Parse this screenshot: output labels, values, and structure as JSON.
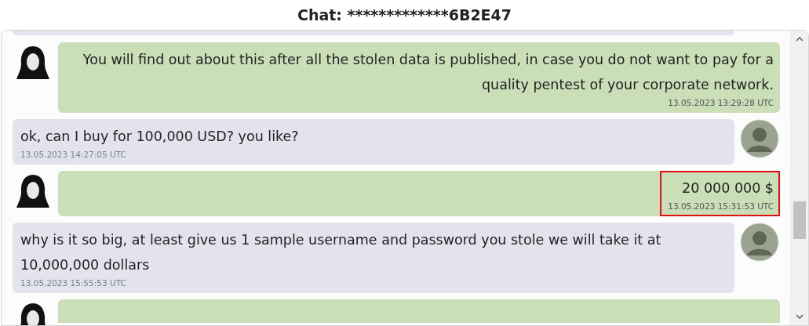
{
  "title": "Chat: *************6B2E47",
  "messages": [
    {
      "outgoing": false,
      "partial": true
    },
    {
      "outgoing": true,
      "partial": false,
      "text": "You will find out about this after all the stolen data is published, in case you do not want to pay for a quality pentest of your corporate network.",
      "time": "13.05.2023 13:29:28 UTC",
      "highlighted": false
    },
    {
      "outgoing": false,
      "partial": false,
      "text": "ok, can I buy for 100,000 USD? you like?",
      "time": "13.05.2023 14:27:05 UTC",
      "highlighted": false
    },
    {
      "outgoing": true,
      "partial": false,
      "text": "20 000 000 $",
      "time": "13.05.2023 15:31:53 UTC",
      "highlighted": true
    },
    {
      "outgoing": false,
      "partial": false,
      "text": "why is it so big, at least give us 1 sample username and password you stole we will take it at 10,000,000 dollars",
      "time": "13.05.2023 15:55:53 UTC",
      "highlighted": false
    },
    {
      "outgoing": true,
      "partial": true
    }
  ]
}
